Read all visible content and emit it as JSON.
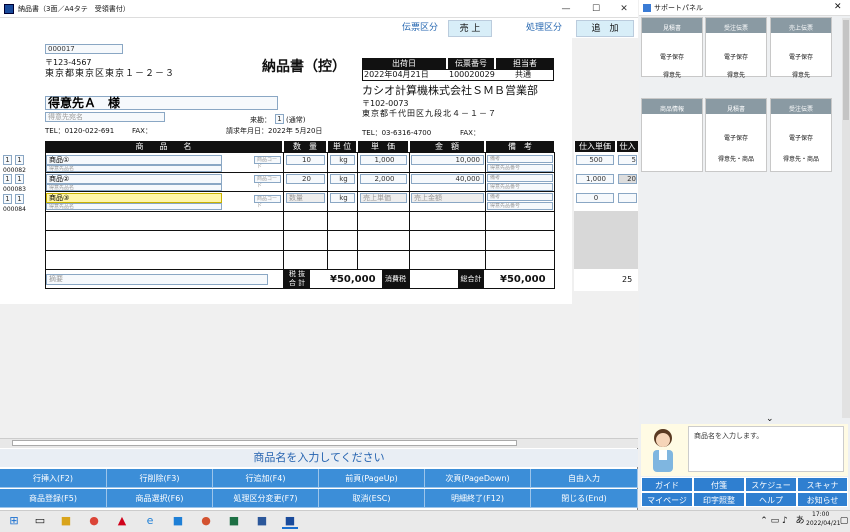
{
  "window": {
    "title": "納品書（3面／A4タテ　受領書付）",
    "min": "—",
    "max": "☐",
    "close": "✕"
  },
  "header": {
    "denpyo_label": "伝票区分",
    "denpyo_value": "売 上",
    "shori_label": "処理区分",
    "shori_value": "追　加"
  },
  "doc": {
    "code": "000017",
    "postal": "〒123-4567",
    "address": "東京都東京区東京１－２－３",
    "title": "納品書（控）",
    "date_hdr": "出荷日",
    "slip_hdr": "伝票番号",
    "person_hdr": "担当者",
    "date": "2022年04月21日",
    "slip": "100020029",
    "person": "共通",
    "company": "カシオ計算機株式会社ＳＭＢ営業部",
    "co_postal": "〒102-0073",
    "co_address": "東京都千代田区九段北４－１－７",
    "co_tel": "TEL：03-6316-4700",
    "co_fax": "FAX：",
    "customer": "得意先Ａ　様",
    "customer_sub": "得意先宛名",
    "tel": "TEL：0120-022-691",
    "fax": "FAX：",
    "billing_label": "来勘：",
    "billing_num": "1",
    "billing_type": "(通常)",
    "billing_date": "請求年月日：2022年 5月20日",
    "col_item": "商　　品　　名",
    "col_qty": "数　量",
    "col_unit": "単 位",
    "col_price": "単　価",
    "col_amount": "金　額",
    "col_note": "備　考",
    "rows": [
      {
        "a": "1",
        "b": "1",
        "code": "000082",
        "name": "商品①",
        "sub": "得意先品名",
        "hint": "商品コード",
        "qty": "10",
        "unit": "kg",
        "price": "1,000",
        "amount": "10,000",
        "note1": "備考",
        "note2": "得意先品番号",
        "cost": "500",
        "cost2": "5"
      },
      {
        "a": "1",
        "b": "1",
        "code": "000083",
        "name": "商品②",
        "sub": "得意先品名",
        "hint": "商品コード",
        "qty": "20",
        "unit": "kg",
        "price": "2,000",
        "amount": "40,000",
        "note1": "備考",
        "note2": "得意先品番号",
        "cost": "1,000",
        "cost2": "20"
      },
      {
        "a": "1",
        "b": "1",
        "code": "000084",
        "name": "商品③",
        "sub": "得意先品名",
        "hint": "商品コード",
        "qty": "数量",
        "unit": "kg",
        "price": "売上単価",
        "amount": "売上金額",
        "note1": "備考",
        "note2": "得意先品番号",
        "cost": "0",
        "cost2": ""
      }
    ],
    "remark": "摘要",
    "tax_lbl1": "税 抜",
    "tax_lbl2": "合 計",
    "subtotal": "¥50,000",
    "tax_lbl": "消費税",
    "total_lbl": "総合計",
    "total": "¥50,000",
    "cost_hdr": "仕入単価",
    "cost_hdr2": "仕入",
    "cost_total": "25"
  },
  "prompt": "商品名を入力してください",
  "fkeys": [
    "行挿入(F2)",
    "行削除(F3)",
    "行追加(F4)",
    "前頁(PageUp)",
    "次頁(PageDown)",
    "自由入力",
    "商品登録(F5)",
    "商品選択(F6)",
    "処理区分変更(F7)",
    "取消(ESC)",
    "明細終了(F12)",
    "閉じる(End)"
  ],
  "support": {
    "title": "サポートパネル",
    "tiles": [
      {
        "head": "見積書",
        "l1": "電子保存",
        "l2": "得意先"
      },
      {
        "head": "受注伝票",
        "l1": "電子保存",
        "l2": "得意先"
      },
      {
        "head": "売上伝票",
        "l1": "電子保存",
        "l2": "得意先"
      },
      {
        "head": "商品情報",
        "l1": "",
        "l2": ""
      },
      {
        "head": "見積書",
        "l1": "電子保存",
        "l2": "得意先・商品"
      },
      {
        "head": "受注伝票",
        "l1": "電子保存",
        "l2": "得意先・商品"
      }
    ],
    "message": "商品名を入力します。",
    "buttons": [
      "ガイド",
      "付箋",
      "スケジュー",
      "スキャナ",
      "マイページ",
      "印字照整",
      "ヘルプ",
      "お知らせ"
    ]
  },
  "taskbar": {
    "time": "17:00",
    "date": "2022/04/21",
    "ime": "あ"
  }
}
